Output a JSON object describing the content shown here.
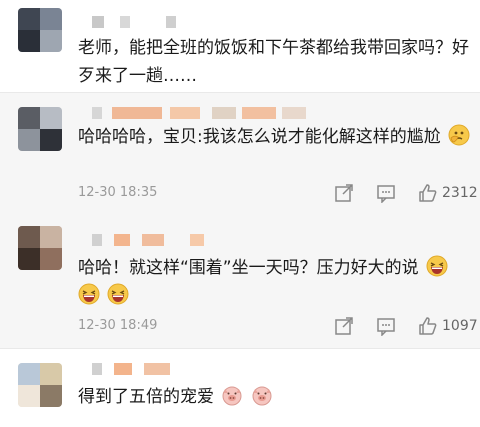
{
  "comments": [
    {
      "text": "老师，能把全班的饭饭和下午茶都给我带回家吗？好歹来了一趟……"
    },
    {
      "text": "哈哈哈哈，宝贝:我该怎么说才能化解这样的尴尬",
      "emoji": "thinking-face-icon",
      "time": "12-30 18:35",
      "likes": "2312"
    },
    {
      "text": "哈哈！就这样“围着”坐一天吗？压力好大的说",
      "emoji": "laughing-face-icon",
      "time": "12-30 18:49",
      "likes": "1097"
    },
    {
      "text": "得到了五倍的宠爱",
      "emoji": "pig-face-icon"
    }
  ]
}
